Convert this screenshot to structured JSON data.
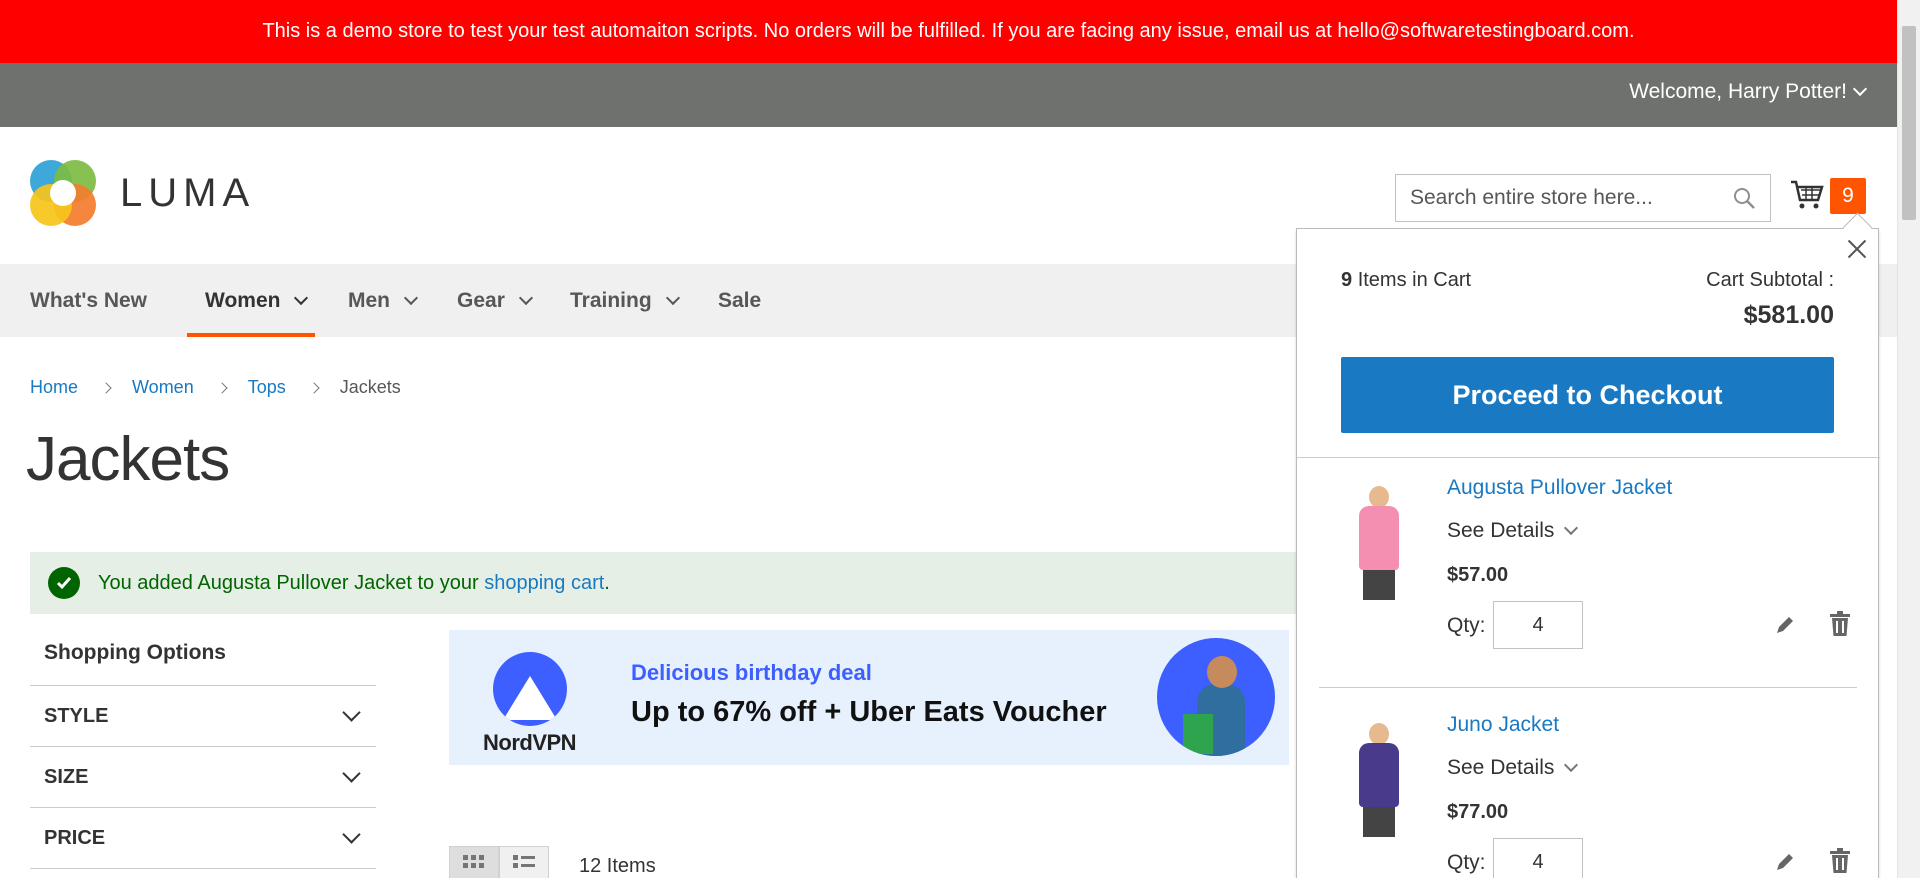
{
  "banner": {
    "text": "This is a demo store to test your test automaiton scripts. No orders will be fulfilled. If you are facing any issue, email us at hello@softwaretestingboard.com."
  },
  "header": {
    "welcome": "Welcome, Harry Potter!",
    "logo_text": "LUMA",
    "search_placeholder": "Search entire store here...",
    "cart_count": "9"
  },
  "nav": {
    "items": [
      {
        "label": "What's New"
      },
      {
        "label": "Women"
      },
      {
        "label": "Men"
      },
      {
        "label": "Gear"
      },
      {
        "label": "Training"
      },
      {
        "label": "Sale"
      }
    ]
  },
  "breadcrumb": {
    "items": [
      "Home",
      "Women",
      "Tops"
    ],
    "current": "Jackets"
  },
  "page": {
    "title": "Jackets"
  },
  "message": {
    "prefix": "You added Augusta Pullover Jacket to your ",
    "link": "shopping cart",
    "suffix": "."
  },
  "sidebar": {
    "title": "Shopping Options",
    "filters": [
      "STYLE",
      "SIZE",
      "PRICE"
    ]
  },
  "ad": {
    "brand": "NordVPN",
    "line1": "Delicious birthday deal",
    "line2": "Up to 67% off + Uber Eats Voucher"
  },
  "toolbar": {
    "items_count": "12 Items"
  },
  "minicart": {
    "count": "9",
    "count_label": "Items in Cart",
    "subtotal_label": "Cart Subtotal :",
    "subtotal": "$581.00",
    "checkout_label": "Proceed to Checkout",
    "see_details": "See Details",
    "qty_label": "Qty:",
    "items": [
      {
        "name": "Augusta Pullover Jacket",
        "price": "$57.00",
        "qty": "4",
        "color": "#f48fb1"
      },
      {
        "name": "Juno Jacket",
        "price": "$77.00",
        "qty": "4",
        "color": "#4a3a8c"
      }
    ]
  }
}
